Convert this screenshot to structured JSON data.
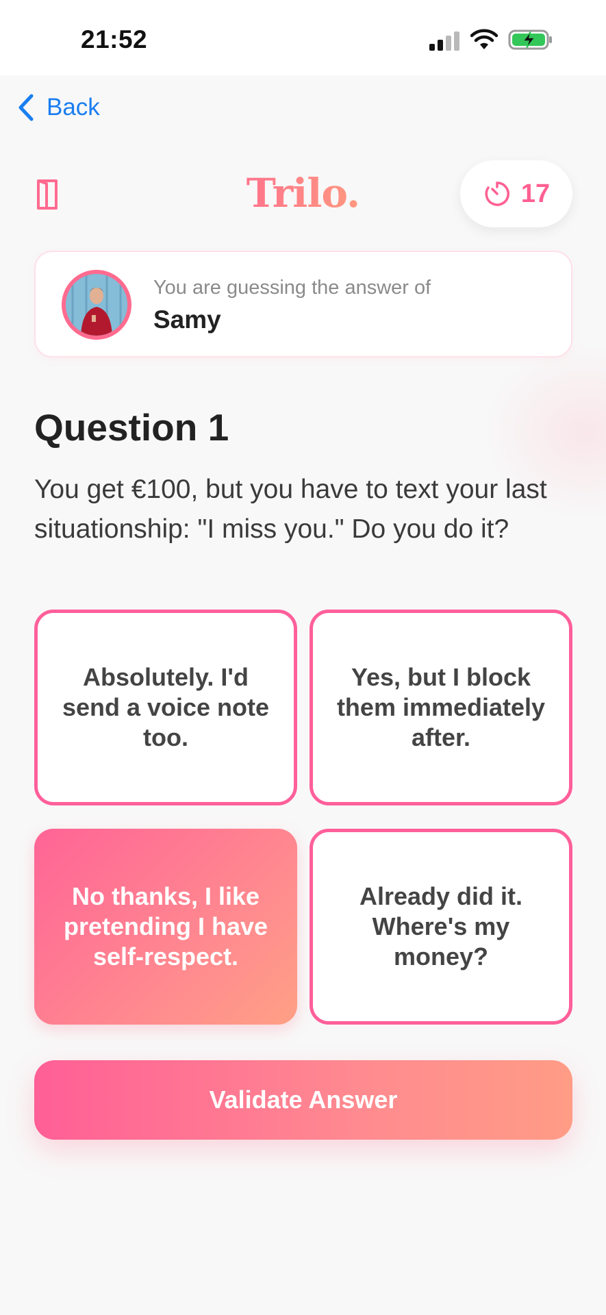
{
  "status_bar": {
    "time": "21:52"
  },
  "nav": {
    "back_label": "Back"
  },
  "header": {
    "logo": "Trilo.",
    "timer_value": "17"
  },
  "player": {
    "caption": "You are guessing the answer of",
    "name": "Samy"
  },
  "question": {
    "title": "Question 1",
    "text": "You get €100, but you have to text your last situationship: \"I miss you.\" Do you do it?"
  },
  "answers": [
    {
      "label": "Absolutely. I'd send a voice note too.",
      "selected": false
    },
    {
      "label": "Yes, but I block them immediately after.",
      "selected": false
    },
    {
      "label": "No thanks, I like pretending I have self-respect.",
      "selected": true
    },
    {
      "label": "Already did it. Where's my money?",
      "selected": false
    }
  ],
  "actions": {
    "validate_label": "Validate Answer"
  },
  "colors": {
    "accent_pink": "#ff5f96",
    "accent_peach": "#ff9c85",
    "link_blue": "#1a7ef0",
    "battery_green": "#33c759"
  },
  "icons": {
    "back": "chevron-left-icon",
    "book": "book-icon",
    "timer": "timer-icon"
  }
}
